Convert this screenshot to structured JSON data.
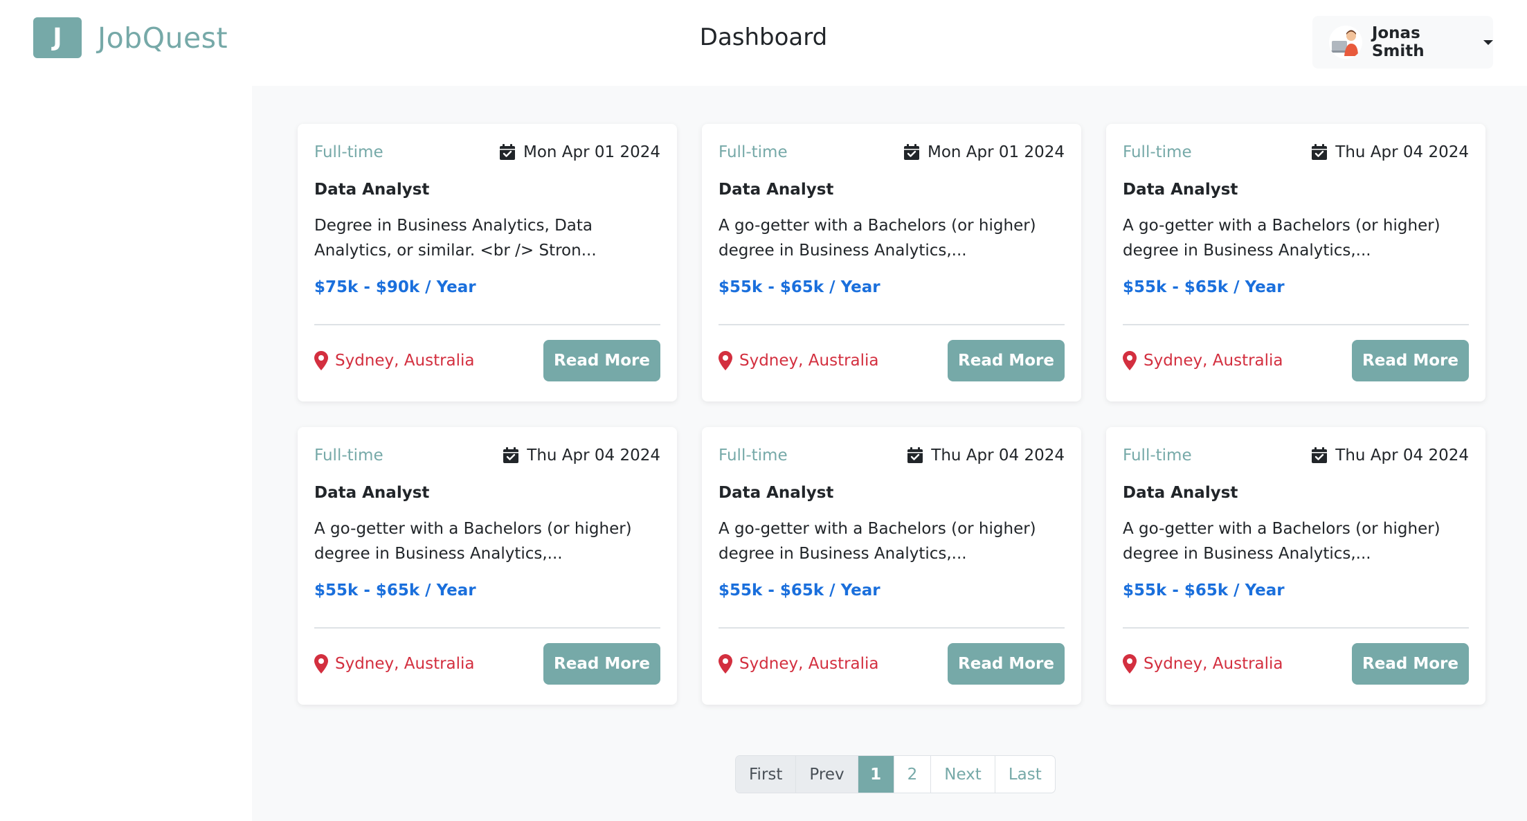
{
  "brand": {
    "logo_letter": "J",
    "name": "JobQuest"
  },
  "header": {
    "title": "Dashboard"
  },
  "user": {
    "name": "Jonas Smith"
  },
  "colors": {
    "accent": "#76a9a8",
    "salary": "#1a6fdc",
    "location": "#d32f3f",
    "background": "#f8f9fa"
  },
  "jobs": [
    {
      "type": "Full-time",
      "date": "Mon Apr 01 2024",
      "title": "Data Analyst",
      "description": "Degree in Business Analytics, Data Analytics, or similar. <br /> Stron...",
      "salary": "$75k - $90k / Year",
      "location": "Sydney, Australia",
      "button": "Read More"
    },
    {
      "type": "Full-time",
      "date": "Mon Apr 01 2024",
      "title": "Data Analyst",
      "description": "A go-getter with a Bachelors (or higher) degree in Business Analytics,...",
      "salary": "$55k - $65k / Year",
      "location": "Sydney, Australia",
      "button": "Read More"
    },
    {
      "type": "Full-time",
      "date": "Thu Apr 04 2024",
      "title": "Data Analyst",
      "description": "A go-getter with a Bachelors (or higher) degree in Business Analytics,...",
      "salary": "$55k - $65k / Year",
      "location": "Sydney, Australia",
      "button": "Read More"
    },
    {
      "type": "Full-time",
      "date": "Thu Apr 04 2024",
      "title": "Data Analyst",
      "description": "A go-getter with a Bachelors (or higher) degree in Business Analytics,...",
      "salary": "$55k - $65k / Year",
      "location": "Sydney, Australia",
      "button": "Read More"
    },
    {
      "type": "Full-time",
      "date": "Thu Apr 04 2024",
      "title": "Data Analyst",
      "description": "A go-getter with a Bachelors (or higher) degree in Business Analytics,...",
      "salary": "$55k - $65k / Year",
      "location": "Sydney, Australia",
      "button": "Read More"
    },
    {
      "type": "Full-time",
      "date": "Thu Apr 04 2024",
      "title": "Data Analyst",
      "description": "A go-getter with a Bachelors (or higher) degree in Business Analytics,...",
      "salary": "$55k - $65k / Year",
      "location": "Sydney, Australia",
      "button": "Read More"
    }
  ],
  "pagination": {
    "first": "First",
    "prev": "Prev",
    "pages": [
      "1",
      "2"
    ],
    "current": "1",
    "next": "Next",
    "last": "Last"
  }
}
